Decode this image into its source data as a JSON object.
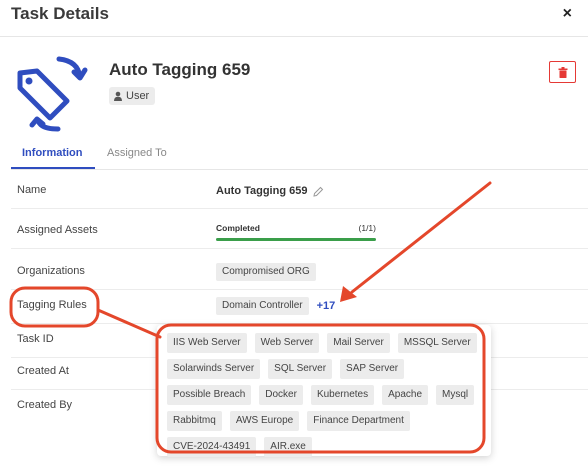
{
  "header": {
    "title": "Task Details",
    "close_symbol": "×"
  },
  "task": {
    "name": "Auto Tagging 659",
    "owner_badge": "User"
  },
  "tabs": [
    {
      "label": "Information",
      "active": true
    },
    {
      "label": "Assigned To",
      "active": false
    }
  ],
  "fields": {
    "name": {
      "label": "Name",
      "value": "Auto Tagging 659"
    },
    "assigned_assets": {
      "label": "Assigned Assets",
      "status": "Completed",
      "count": "(1/1)",
      "progress": 1.0
    },
    "organizations": {
      "label": "Organizations",
      "value": "Compromised ORG"
    },
    "tagging_rules": {
      "label": "Tagging Rules",
      "value": "Domain Controller",
      "more": "+17"
    },
    "task_id": {
      "label": "Task ID"
    },
    "created_at": {
      "label": "Created At"
    },
    "created_by": {
      "label": "Created By"
    }
  },
  "tagging_rules_popover": [
    "IIS Web Server",
    "Web Server",
    "Mail Server",
    "MSSQL Server",
    "Solarwinds Server",
    "SQL Server",
    "SAP Server",
    "Possible Breach",
    "Docker",
    "Kubernetes",
    "Apache",
    "Mysql",
    "Rabbitmq",
    "AWS Europe",
    "Finance Department",
    "CVE-2024-43491",
    "AIR.exe"
  ],
  "colors": {
    "accent": "#2f4dbf",
    "danger": "#e53935",
    "success": "#3a9e4a",
    "annotation": "#e4472b"
  },
  "icons": [
    "close-icon",
    "tag-sync-icon",
    "user-icon",
    "trash-icon",
    "pencil-icon"
  ]
}
